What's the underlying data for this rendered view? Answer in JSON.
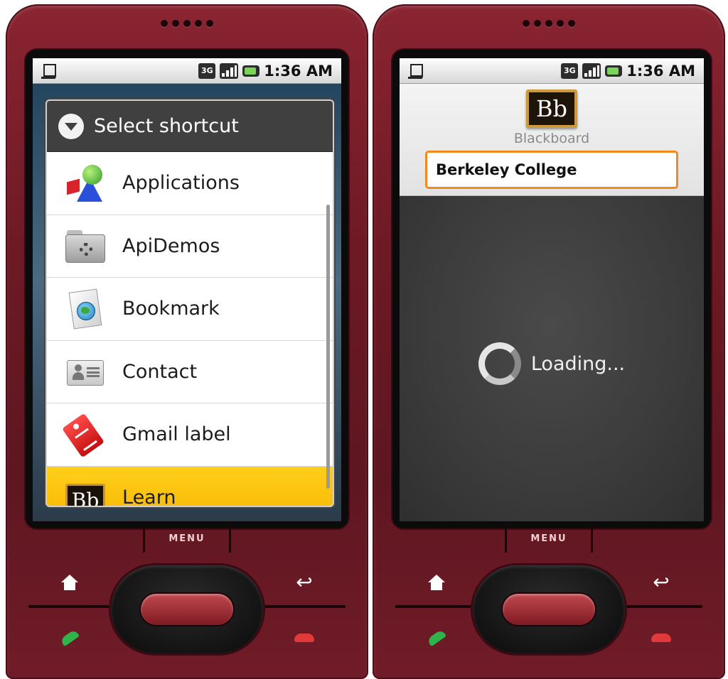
{
  "left_phone": {
    "status": {
      "time": "1:36 AM",
      "network": "3G"
    },
    "dialog": {
      "title": "Select shortcut",
      "items": [
        {
          "label": "Applications",
          "icon": "applications-icon"
        },
        {
          "label": "ApiDemos",
          "icon": "folder-gear-icon"
        },
        {
          "label": "Bookmark",
          "icon": "bookmark-globe-icon"
        },
        {
          "label": "Contact",
          "icon": "contact-card-icon"
        },
        {
          "label": "Gmail label",
          "icon": "gmail-label-tag-icon"
        },
        {
          "label": "Learn",
          "icon": "blackboard-learn-icon",
          "selected": true
        }
      ]
    },
    "hardware": {
      "menu_label": "MENU"
    }
  },
  "right_phone": {
    "status": {
      "time": "1:36 AM",
      "network": "3G"
    },
    "app": {
      "logo_text": "Bb",
      "brand": "Blackboard",
      "school": "Berkeley College",
      "loading_text": "Loading..."
    },
    "hardware": {
      "menu_label": "MENU"
    }
  },
  "colors": {
    "phone_body": "#6e1a25",
    "selected_highlight": "#f7b400",
    "school_field_border": "#f08a1c",
    "chalkboard": "#3b3b3b"
  }
}
